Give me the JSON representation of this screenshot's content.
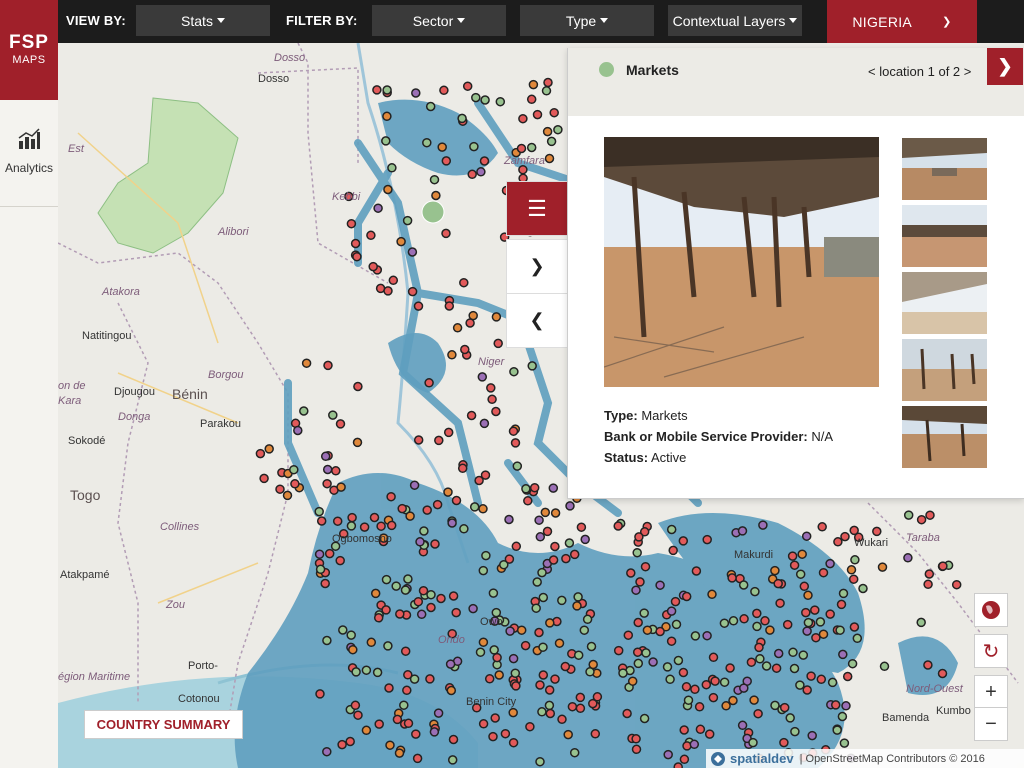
{
  "topbar": {
    "view_by_label": "VIEW BY:",
    "view_by_value": "Stats",
    "filter_by_label": "FILTER BY:",
    "filters": [
      "Sector",
      "Type",
      "Contextual Layers"
    ],
    "country": "NIGERIA"
  },
  "sidebar": {
    "logo_line1": "FSP",
    "logo_line2": "MAPS",
    "analytics_label": "Analytics",
    "analytics_icon": "bar-chart-icon"
  },
  "map": {
    "labels": {
      "dosso_italic": "Dosso",
      "dosso_city": "Dosso",
      "kebbi": "Kebbi",
      "zamfara": "Zamfara",
      "est": "Est",
      "alibori": "Alibori",
      "atakora": "Atakora",
      "natitingou": "Natitingou",
      "borgou": "Borgou",
      "benin": "Bénin",
      "djougou": "Djougou",
      "donga": "Donga",
      "parakou": "Parakou",
      "niger": "Niger",
      "kara": "Kara",
      "on_de": "on de",
      "sokode": "Sokodé",
      "togo": "Togo",
      "collines": "Collines",
      "atakpame": "Atakpamé",
      "zou": "Zou",
      "porto": "Porto-",
      "cotonou": "Cotonou",
      "region_maritime": "égion Maritime",
      "taraba": "Taraba",
      "wukari": "Wukari",
      "nord_ouest": "Nord-Ouest",
      "bamenda": "Bamenda",
      "kumbo": "Kumbo",
      "benin_city": "Benin City",
      "ondo": "Ondo",
      "owo": "Owo",
      "ogbomosho": "Ogbomosho",
      "makurdi": "Makurdi"
    },
    "country_summary_label": "COUNTRY SUMMARY",
    "attribution_brand": "spatialdev",
    "attribution_text": "| OpenStreetMap Contributors © 2016",
    "colors": {
      "water_blob": "#5f9fbf",
      "marker_red": "#e25a5a",
      "marker_green": "#98c28f",
      "marker_purple": "#9b6fb5",
      "marker_orange": "#e0883b",
      "brand_red": "#a0202a"
    }
  },
  "popup": {
    "title": "Markets",
    "nav_text": "< location 1 of 2 >",
    "next_icon": "chevron-right-icon",
    "properties": [
      {
        "label": "Type:",
        "value": "Markets"
      },
      {
        "label": "Bank or Mobile Service Provider:",
        "value": "N/A"
      },
      {
        "label": "Status:",
        "value": "Active"
      }
    ]
  },
  "panel_buttons": {
    "menu_icon": "hamburger-icon",
    "forward_icon": "chevron-right-icon",
    "back_icon": "chevron-left-icon"
  },
  "map_controls": {
    "locate_icon": "globe-icon",
    "reset_icon": "refresh-icon",
    "zoom_in": "+",
    "zoom_out": "−"
  }
}
